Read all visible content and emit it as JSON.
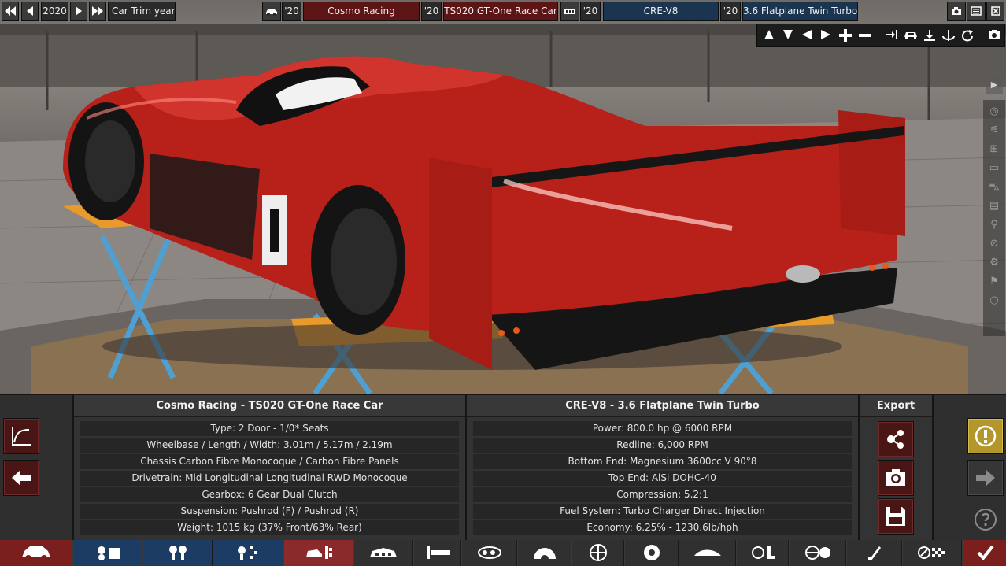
{
  "topbar": {
    "year": "2020",
    "car_trim_label": "Car Trim year",
    "model_year": "'20",
    "family_name": "Cosmo Racing",
    "trim_year": "'20",
    "trim_name": "TS020 GT-One Race Car",
    "engine_year": "'20",
    "engine_family": "CRE-V8",
    "variant_year": "'20",
    "variant_name": "3.6 Flatplane Twin Turbo"
  },
  "car_section": {
    "header": "Cosmo Racing - TS020 GT-One Race Car",
    "rows": [
      "Type: 2 Door - 1/0* Seats",
      "Wheelbase / Length / Width: 3.01m / 5.17m / 2.19m",
      "Chassis Carbon Fibre Monocoque / Carbon Fibre Panels",
      "Drivetrain: Mid Longitudinal Longitudinal RWD Monocoque",
      "Gearbox: 6 Gear Dual Clutch",
      "Suspension: Pushrod (F) / Pushrod (R)",
      "Weight: 1015 kg (37% Front/63% Rear)"
    ]
  },
  "engine_section": {
    "header": "CRE-V8 - 3.6 Flatplane Twin Turbo",
    "rows": [
      "Power: 800.0 hp @ 6000 RPM",
      "Redline:  6,000 RPM",
      "Bottom End: Magnesium 3600cc V 90°8",
      "Top End: AlSi DOHC-40",
      "Compression: 5.2:1",
      "Fuel System: Turbo Charger Direct Injection",
      "Economy: 6.25% - 1230.6lb/hph"
    ]
  },
  "export_section": {
    "header": "Export"
  },
  "colors": {
    "accent_red": "#7a1e1e",
    "accent_blue": "#1d3c63",
    "warning_gold": "#b3972a",
    "panel_bg": "#333333"
  },
  "icons": {
    "topbar": [
      "skip-back-icon",
      "prev-icon",
      "next-icon",
      "skip-forward-icon",
      "car-icon",
      "engine-block-icon",
      "camera-icon",
      "list-icon",
      "close-icon"
    ],
    "camera_tools": [
      "arrow-up-icon",
      "arrow-down-icon",
      "arrow-left-icon",
      "arrow-right-icon",
      "zoom-in-icon",
      "zoom-out-icon",
      "align-icon",
      "car-view-icon",
      "ground-icon",
      "rotate-icon",
      "reset-icon",
      "screenshot-icon"
    ],
    "export": [
      "share-icon",
      "camera-icon",
      "save-icon"
    ],
    "left_panel": [
      "graph-icon",
      "back-arrow-icon"
    ],
    "right_panel": [
      "warning-icon",
      "forward-arrow-icon",
      "help-icon"
    ]
  }
}
